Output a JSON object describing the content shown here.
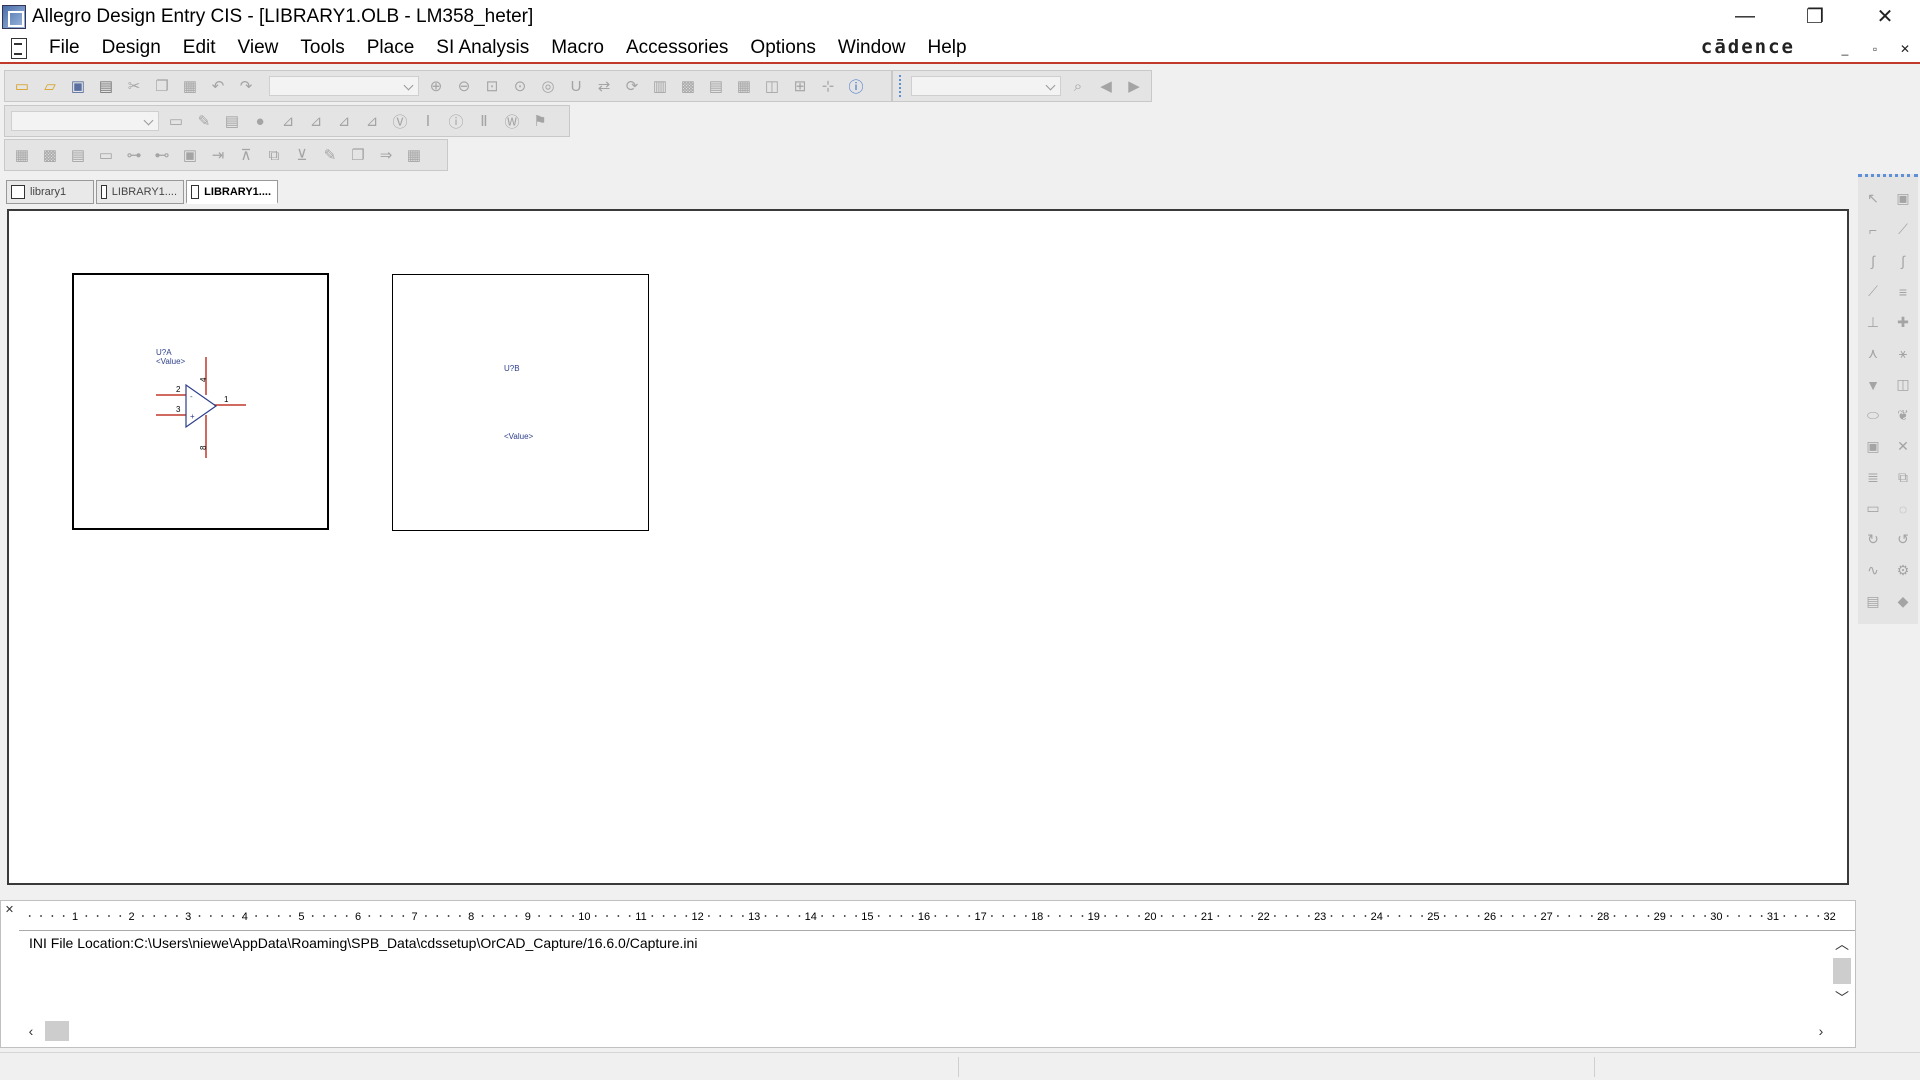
{
  "window": {
    "title": "Allegro Design Entry CIS - [LIBRARY1.OLB - LM358_heter]",
    "controls": [
      "—",
      "❐",
      "✕"
    ]
  },
  "menu": {
    "items": [
      "File",
      "Design",
      "Edit",
      "View",
      "Tools",
      "Place",
      "SI Analysis",
      "Macro",
      "Accessories",
      "Options",
      "Window",
      "Help"
    ],
    "brand": "cādence",
    "mdi_controls": [
      "_",
      "▫",
      "✕"
    ]
  },
  "toolbars": {
    "main": [
      "new-icon",
      "open-icon",
      "save-icon",
      "print-icon",
      "cut-icon",
      "copy-icon",
      "paste-icon",
      "undo-icon",
      "redo-icon",
      "zoom-in-icon",
      "zoom-out-icon",
      "zoom-area-icon",
      "zoom-all-icon",
      "browse-icon",
      "annotate-icon",
      "backannotate-icon",
      "update-part-icon",
      "netlist-icon",
      "drc-icon",
      "bom-icon",
      "cross-ref-icon",
      "part-manager-icon",
      "snap-grid-icon",
      "project-manager-icon",
      "help-icon"
    ],
    "search": [
      "find-icon",
      "back-icon",
      "forward-icon"
    ],
    "pspice": [
      "new-sim-icon",
      "edit-sim-icon",
      "run-icon",
      "view-sim-icon",
      "voltage-marker-icon",
      "current-marker-icon",
      "power-marker-icon",
      "diff-marker-icon",
      "bias-v-icon",
      "bias-i-icon",
      "bias-w-icon",
      "toggle-icon"
    ],
    "cis": [
      "cis-part-icon",
      "cis-explorer-icon",
      "cis-query-icon",
      "cis-link-icon",
      "cis-unlink-icon",
      "cis-update-icon",
      "cis-place-icon",
      "cis-refresh-icon",
      "cis-tree-icon",
      "cis-view-icon",
      "cis-edit-icon",
      "cis-copy-icon",
      "cis-table-icon"
    ]
  },
  "tabs": [
    {
      "label": "library1",
      "active": false
    },
    {
      "label": "LIBRARY1....",
      "active": false
    },
    {
      "label": "LIBRARY1....",
      "active": true
    }
  ],
  "parts": {
    "a": {
      "ref": "U?A",
      "value": "<Value>",
      "pins": {
        "inv": "2",
        "noninv": "3",
        "out": "1",
        "vpos": "4",
        "vneg": "8"
      }
    },
    "b": {
      "ref": "U?B",
      "value": "<Value>"
    }
  },
  "right_toolbar": [
    "select-icon",
    "place-part-icon",
    "place-wire-icon",
    "place-net-alias-icon",
    "place-bus-icon",
    "place-junction-icon",
    "place-bus-entry-icon",
    "place-net-alias-text-icon",
    "place-power-icon",
    "place-ground-icon",
    "place-offpage-icon",
    "place-noconnect-icon",
    "place-hier-block-icon",
    "place-hier-port-icon",
    "place-hier-pin-icon",
    "place-offpage-connector-icon",
    "place-line-icon",
    "place-polyline-icon",
    "place-rectangle-icon",
    "place-ellipse-icon",
    "place-arc-icon",
    "place-elliptical-arc-icon",
    "place-bezier-icon",
    "place-text-icon",
    "place-picture-icon",
    "place-ieee-icon",
    "place-pin-icon",
    "place-pin-array-icon"
  ],
  "session_log": {
    "text": "INI File Location:C:\\Users\\niewe\\AppData\\Roaming\\SPB_Data\\cdssetup\\OrCAD_Capture/16.6.0/Capture.ini",
    "ruler_labels": [
      "1",
      "2",
      "3",
      "4",
      "5",
      "6",
      "7",
      "8",
      "9",
      "10",
      "11",
      "12",
      "13",
      "14",
      "15",
      "16",
      "17",
      "18",
      "19",
      "20",
      "21",
      "22",
      "23",
      "24",
      "25",
      "26",
      "27",
      "28",
      "29",
      "30",
      "31",
      "32"
    ]
  }
}
